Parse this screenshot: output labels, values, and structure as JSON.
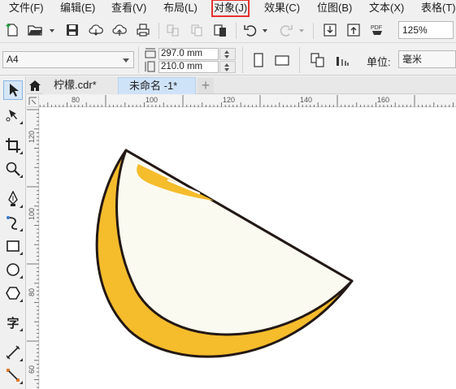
{
  "menu": {
    "items": [
      {
        "label": "文件(F)"
      },
      {
        "label": "编辑(E)"
      },
      {
        "label": "查看(V)"
      },
      {
        "label": "布局(L)"
      },
      {
        "label": "对象(J)"
      },
      {
        "label": "效果(C)"
      },
      {
        "label": "位图(B)"
      },
      {
        "label": "文本(X)"
      },
      {
        "label": "表格(T)"
      }
    ],
    "highlighted_label": "对象(J)",
    "highlight_color": "#e5322d"
  },
  "toolbar": {
    "zoom_value": "125%",
    "icons": [
      "new-document-icon",
      "open-folder-icon",
      "save-icon",
      "cloud-download-icon",
      "cloud-upload-icon",
      "print-icon",
      "cut-icon",
      "copy-icon",
      "paste-icon",
      "undo-icon",
      "redo-icon",
      "import-icon",
      "export-icon",
      "export-pdf-icon"
    ],
    "pdf_label": "PDF"
  },
  "property_bar": {
    "page_size": "A4",
    "width_value": "297.0 mm",
    "height_value": "210.0 mm",
    "units_label": "单位:",
    "units_value": "毫米"
  },
  "tabs": {
    "items": [
      {
        "label": "柠檬.cdr*",
        "active": false
      },
      {
        "label": "未命名 -1*",
        "active": true
      }
    ],
    "add_symbol": "+"
  },
  "rulers": {
    "horizontal_ticks": [
      "80",
      "100",
      "120",
      "140",
      "160"
    ],
    "vertical_ticks": [
      "120",
      "100",
      "80",
      "60"
    ]
  },
  "toolbox": {
    "tools": [
      "pick-tool-icon",
      "shape-tool-icon",
      "crop-tool-icon",
      "zoom-tool-icon",
      "pen-tool-icon",
      "artistic-media-icon",
      "rectangle-tool-icon",
      "ellipse-tool-icon",
      "polygon-tool-icon",
      "text-tool-icon",
      "dimension-tool-icon",
      "connector-tool-icon"
    ],
    "text_tool_label": "字"
  },
  "artwork": {
    "rind_color": "#f5bc2c",
    "flesh_color": "#fafaf0",
    "outline_color": "#231815"
  }
}
